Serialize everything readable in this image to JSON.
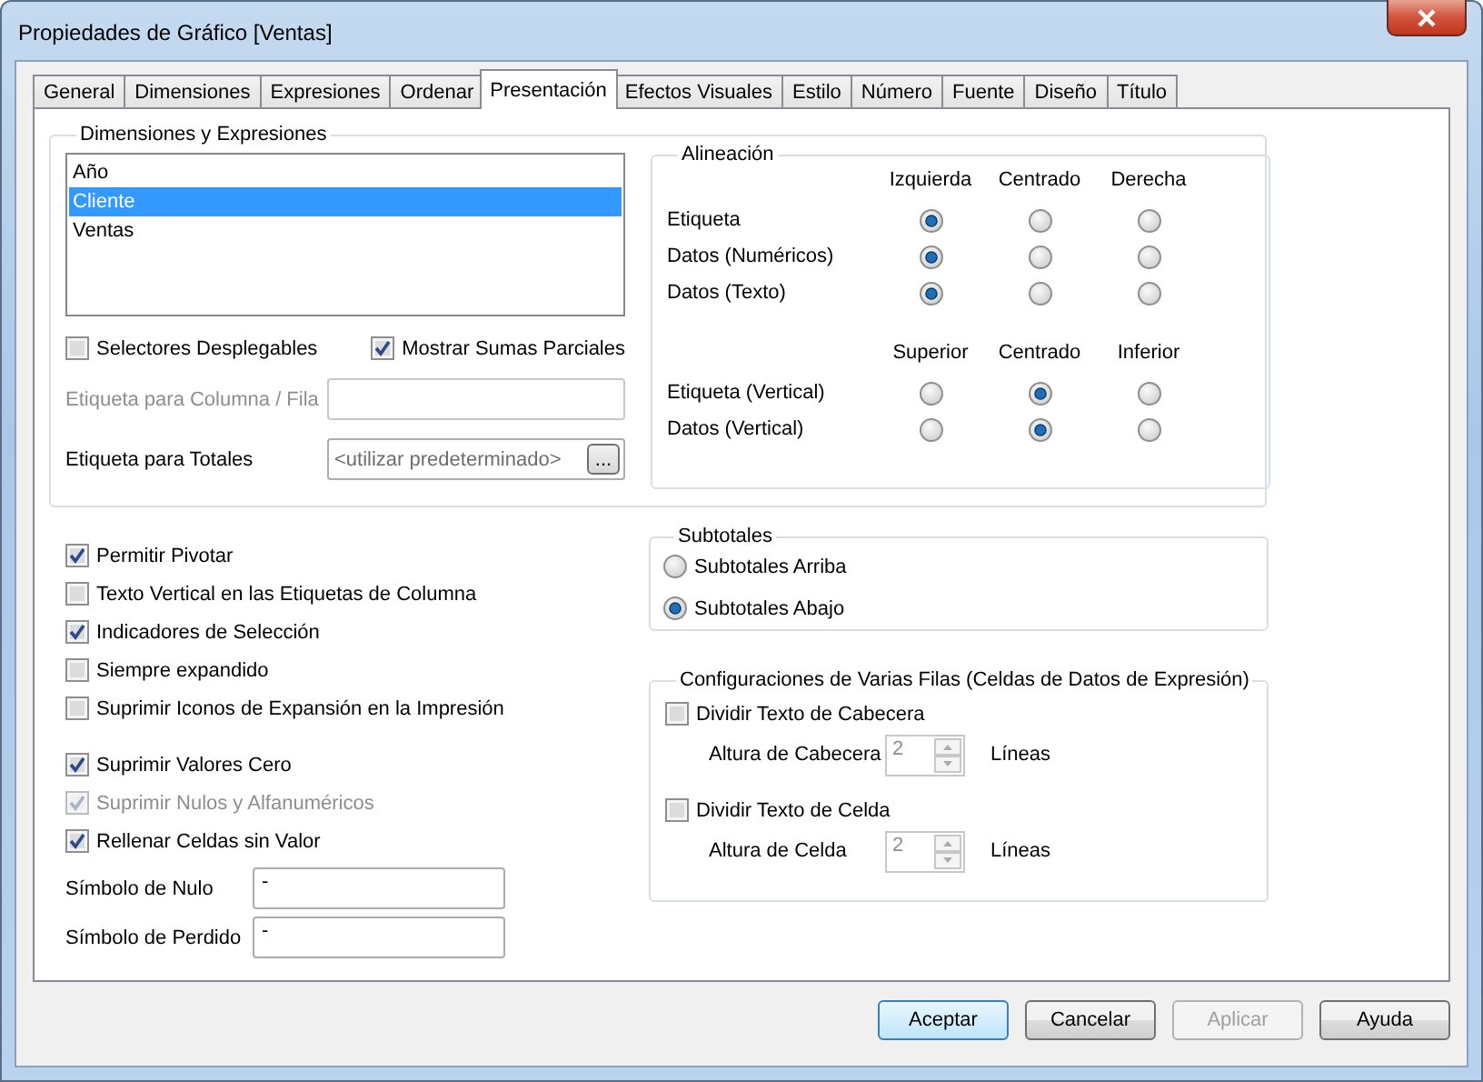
{
  "window": {
    "title": "Propiedades de Gráfico [Ventas]"
  },
  "tabs": [
    {
      "label": "General",
      "selected": false
    },
    {
      "label": "Dimensiones",
      "selected": false
    },
    {
      "label": "Expresiones",
      "selected": false
    },
    {
      "label": "Ordenar",
      "selected": false
    },
    {
      "label": "Presentación",
      "selected": true
    },
    {
      "label": "Efectos Visuales",
      "selected": false
    },
    {
      "label": "Estilo",
      "selected": false
    },
    {
      "label": "Número",
      "selected": false
    },
    {
      "label": "Fuente",
      "selected": false
    },
    {
      "label": "Diseño",
      "selected": false
    },
    {
      "label": "Título",
      "selected": false
    }
  ],
  "dimensions_group": {
    "legend": "Dimensiones y Expresiones",
    "items": [
      {
        "label": "Año",
        "selected": false
      },
      {
        "label": "Cliente",
        "selected": true
      },
      {
        "label": "Ventas",
        "selected": false
      }
    ],
    "options": [
      {
        "label": "Selectores Desplegables",
        "checked": false
      },
      {
        "label": "Mostrar Sumas Parciales",
        "checked": true
      }
    ],
    "fields": [
      {
        "label": "Etiqueta para Columna / Fila",
        "disabled": true
      },
      {
        "label": "Etiqueta para Totales",
        "disabled": false,
        "placeholder": "<utilizar predeterminado>",
        "button": "..."
      }
    ]
  },
  "alignment": {
    "legend": "Alineación",
    "sections": [
      {
        "columns": [
          "Izquierda",
          "Centrado",
          "Derecha"
        ],
        "rows": [
          {
            "label": "Etiqueta",
            "options": [
              {
                "selected": true
              },
              {
                "selected": false
              },
              {
                "selected": false
              }
            ]
          },
          {
            "label": "Datos (Numéricos)",
            "options": [
              {
                "selected": true
              },
              {
                "selected": false
              },
              {
                "selected": false
              }
            ]
          },
          {
            "label": "Datos (Texto)",
            "options": [
              {
                "selected": true
              },
              {
                "selected": false
              },
              {
                "selected": false
              }
            ]
          }
        ]
      },
      {
        "columns": [
          "Superior",
          "Centrado",
          "Inferior"
        ],
        "rows": [
          {
            "label": "Etiqueta (Vertical)",
            "options": [
              {
                "selected": false
              },
              {
                "selected": true
              },
              {
                "selected": false
              }
            ]
          },
          {
            "label": "Datos (Vertical)",
            "options": [
              {
                "selected": false
              },
              {
                "selected": true
              },
              {
                "selected": false
              }
            ]
          }
        ]
      }
    ]
  },
  "display_options": [
    {
      "label": "Permitir Pivotar",
      "checked": true,
      "disabled": false
    },
    {
      "label": "Texto Vertical en las Etiquetas de Columna",
      "checked": false,
      "disabled": false
    },
    {
      "label": "Indicadores de Selección",
      "checked": true,
      "disabled": false
    },
    {
      "label": "Siempre expandido",
      "checked": false,
      "disabled": false
    },
    {
      "label": "Suprimir Iconos de Expansión en la Impresión",
      "checked": false,
      "disabled": false
    }
  ],
  "suppress_options": [
    {
      "label": "Suprimir Valores Cero",
      "checked": true,
      "disabled": false
    },
    {
      "label": "Suprimir Nulos y Alfanuméricos",
      "checked": true,
      "disabled": true
    },
    {
      "label": "Rellenar Celdas sin Valor",
      "checked": true,
      "disabled": false
    }
  ],
  "symbols": [
    {
      "label": "Símbolo de Nulo",
      "value": "-"
    },
    {
      "label": "Símbolo de Perdido",
      "value": "-"
    }
  ],
  "subtotals": {
    "legend": "Subtotales",
    "options": [
      {
        "label": "Subtotales Arriba",
        "selected": false
      },
      {
        "label": "Subtotales Abajo",
        "selected": true
      }
    ]
  },
  "multi_row": {
    "legend": "Configuraciones de Varias Filas (Celdas de Datos de Expresión)",
    "items": [
      {
        "label": "Dividir Texto de Cabecera",
        "checked": false,
        "height_label": "Altura de Cabecera",
        "value": "2",
        "unit": "Líneas",
        "disabled": true
      },
      {
        "label": "Dividir Texto de Celda",
        "checked": false,
        "height_label": "Altura de Celda",
        "value": "2",
        "unit": "Líneas",
        "disabled": true
      }
    ]
  },
  "buttons": [
    {
      "label": "Aceptar",
      "default": true,
      "disabled": false
    },
    {
      "label": "Cancelar",
      "default": false,
      "disabled": false
    },
    {
      "label": "Aplicar",
      "default": false,
      "disabled": true
    },
    {
      "label": "Ayuda",
      "default": false,
      "disabled": false
    }
  ]
}
